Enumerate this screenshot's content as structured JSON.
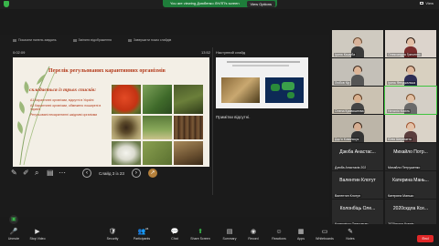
{
  "topbar": {
    "share_notice": "You are viewing Дзюбенко ЛНЛП's screen",
    "view_options": "View Options",
    "view_label": "View"
  },
  "presenter": {
    "toolbar": [
      "Показати панель завдань",
      "Змінити відображення",
      "Завершити показ слайдів"
    ],
    "timer": "0:02:09",
    "clock": "13:52",
    "next_label": "Наступний слайд",
    "notes": "Примітки відсутні.",
    "slide_counter": "Слайд 3 із 23"
  },
  "slide": {
    "title": "Перелік регульованих карантинних організмів",
    "subtitle": "складається із трьох списків:",
    "bullets": [
      "А1 Карантинні організми, відсутні в Україні",
      "А2 Карантинні організми, обмежено поширені в Україні",
      "Регульовані некарантинні шкідливі організми"
    ]
  },
  "gallery": [
    {
      "name": "Ірина Кашуба",
      "type": "video",
      "skin": "#d8b39a",
      "hair": "#6b4a2f",
      "bg": "#cfcac0",
      "shirt": "#3a3a3a"
    },
    {
      "name": "Олександра Гриченко",
      "type": "video",
      "skin": "#e3bfa6",
      "hair": "#2a1a12",
      "bg": "#dcd4cc",
      "shirt": "#7a2c2c"
    },
    {
      "name": "Любов Кір",
      "type": "video",
      "skin": "#dcb496",
      "hair": "#3d2a1f",
      "bg": "#c4c0b8",
      "shirt": "#555"
    },
    {
      "name": "Ірина Фенджалька",
      "type": "video",
      "skin": "#e0b89c",
      "hair": "#4a2d1c",
      "bg": "#d8d0c0",
      "shirt": "#2d2d55"
    },
    {
      "name": "Олена Кривошеєва",
      "type": "video",
      "skin": "#d9b08e",
      "hair": "#5a3a22",
      "bg": "#cbc2b2",
      "shirt": "#444"
    },
    {
      "name": "Наталія Кисіль",
      "type": "video",
      "skin": "#e2bfa2",
      "hair": "#7a4e2a",
      "bg": "#d4cfc6",
      "shirt": "#6a6a6a"
    },
    {
      "name": "Дар'я Ковальчук",
      "type": "video",
      "skin": "#d7ae92",
      "hair": "#3a281b",
      "bg": "#bcb5a8",
      "shirt": "#333"
    },
    {
      "name": "Юлія Шеремета",
      "type": "video",
      "skin": "#e4c2a8",
      "hair": "#a0522d",
      "bg": "#dad3c8",
      "shirt": "#5a3d3d"
    },
    {
      "name": "Дзюба Анастасія 202",
      "big": "Дзюба Анастас...",
      "type": "text"
    },
    {
      "name": "Михайло Петрушенко",
      "big": "Михайло Потр...",
      "type": "text"
    },
    {
      "name": "Валентин Клотун",
      "big": "Валентин Клотут",
      "type": "text"
    },
    {
      "name": "Катерина Манько",
      "big": "Катерина Мань...",
      "type": "text"
    },
    {
      "name": "Колесніцук Олександр",
      "big": "Колонбіць Оле...",
      "type": "text"
    },
    {
      "name": "2020скдла Ксенія",
      "big": "2020скдла Ксе...",
      "type": "text"
    }
  ],
  "toolbar": {
    "buttons": [
      {
        "label": "Unmute",
        "icon": "🎤"
      },
      {
        "label": "Stop Video",
        "icon": "▶"
      },
      {
        "label": "Security",
        "icon": "🛡"
      },
      {
        "label": "Participants",
        "icon": "👥"
      },
      {
        "label": "Chat",
        "icon": "💬"
      },
      {
        "label": "Share Screen",
        "icon": "⬆"
      },
      {
        "label": "Summary",
        "icon": "▤"
      },
      {
        "label": "Record",
        "icon": "◉"
      },
      {
        "label": "Reactions",
        "icon": "☺"
      },
      {
        "label": "Apps",
        "icon": "▦"
      },
      {
        "label": "Whiteboards",
        "icon": "▭"
      },
      {
        "label": "Notes",
        "icon": "✎"
      }
    ],
    "participants_count": "24",
    "end_label": "End"
  },
  "colors": {
    "accent_green": "#1e7d3a",
    "end_red": "#e02828",
    "slide_title": "#b33a1a"
  }
}
